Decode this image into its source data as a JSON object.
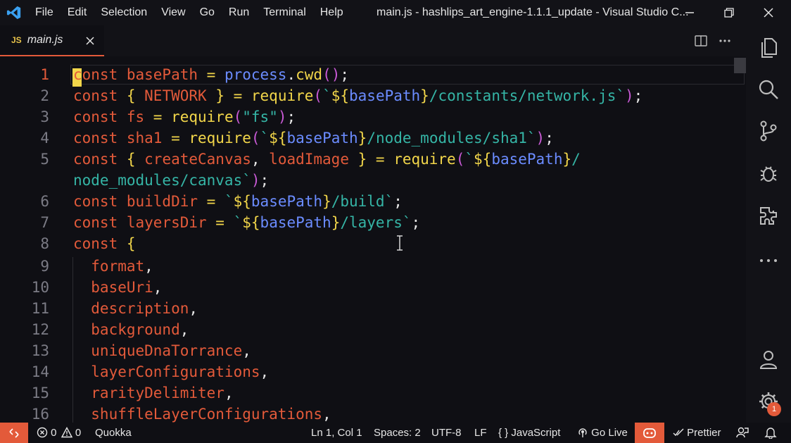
{
  "titlebar": {
    "menu": [
      "File",
      "Edit",
      "Selection",
      "View",
      "Go",
      "Run",
      "Terminal",
      "Help"
    ],
    "window_title": "main.js - hashlips_art_engine-1.1.1_update - Visual Studio C..."
  },
  "tab": {
    "icon_text": "JS",
    "label": "main.js"
  },
  "editor": {
    "line_numbers": [
      "1",
      "2",
      "3",
      "4",
      "5",
      "",
      "6",
      "7",
      "8",
      "9",
      "10",
      "11",
      "12",
      "13",
      "14",
      "15",
      "16"
    ]
  },
  "statusbar": {
    "errors": "0",
    "warnings": "0",
    "quokka": "Quokka",
    "position": "Ln 1, Col 1",
    "spaces": "Spaces: 2",
    "encoding": "UTF-8",
    "eol": "LF",
    "language": "JavaScript",
    "language_icon": "{ }",
    "golive": "Go Live",
    "prettier": "Prettier"
  },
  "activitybar": {
    "settings_badge": "1"
  },
  "colors": {
    "accent": "#e35a3a",
    "background": "#0f0f14",
    "keyword": "#e35a3a",
    "function": "#f2d64a",
    "string": "#35b5a6",
    "template": "#6b8cff"
  }
}
